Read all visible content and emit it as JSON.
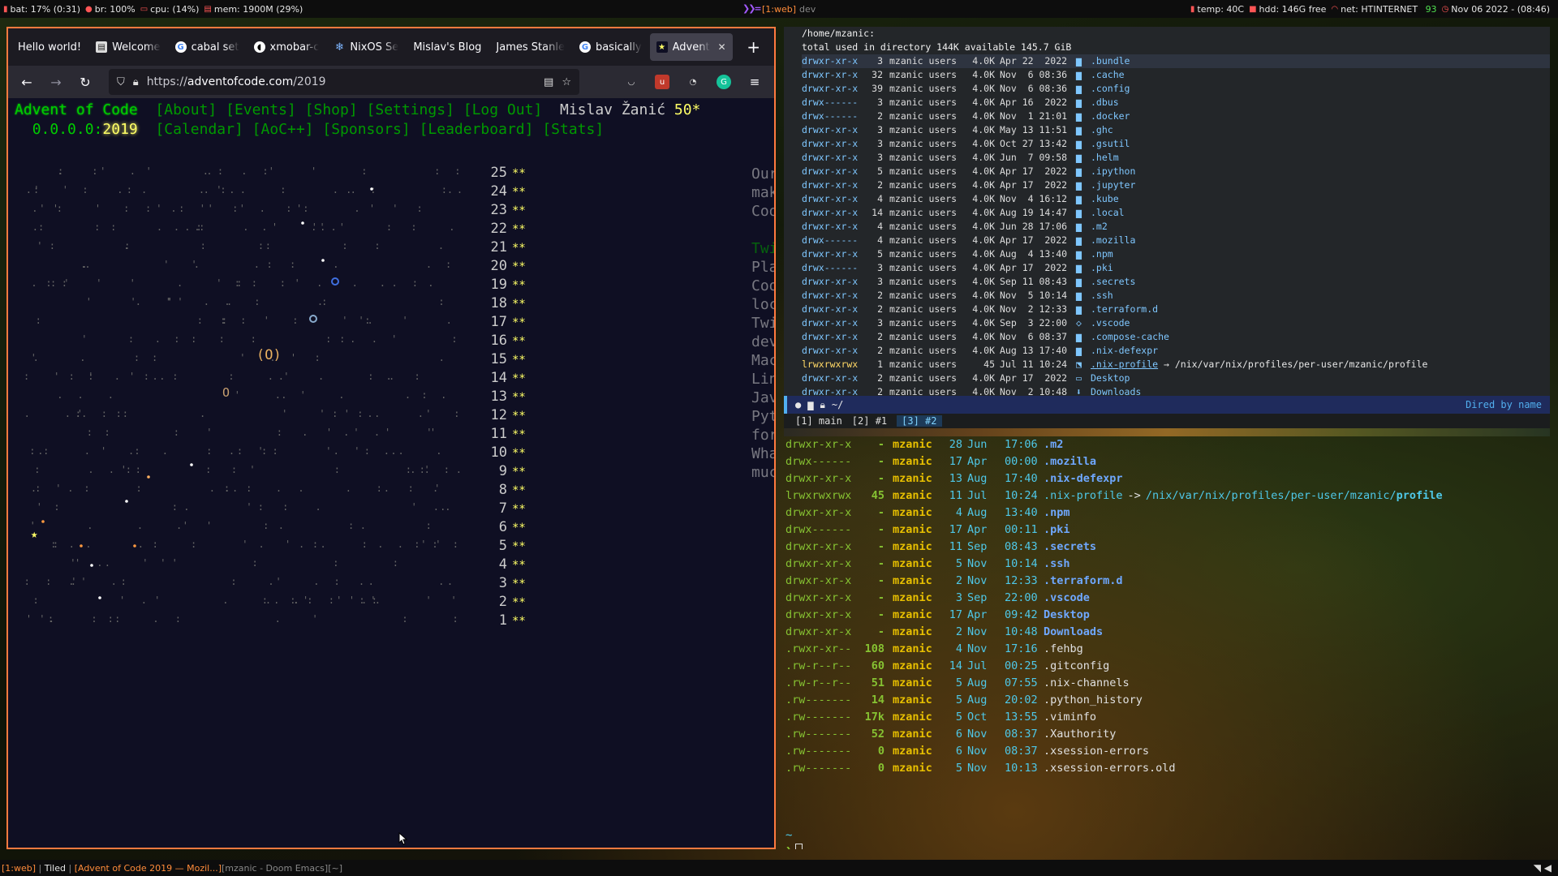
{
  "topbar": {
    "battery": "bat: 17% (0:31)",
    "brightness": "br: 100%",
    "cpu": "cpu: (14%)",
    "mem": "mem: 1900M (29%)",
    "workspace": "[1:web]",
    "workspace_name": "dev",
    "temp": "temp: 40C",
    "hdd": "hdd: 146G free",
    "net": "net: HTINTERNET",
    "net_strength": "93",
    "datetime": "Nov 06 2022 - (08:46)"
  },
  "firefox": {
    "tabs": [
      {
        "label": "Hello world!",
        "icon": "none"
      },
      {
        "label": "Welcome",
        "icon": "book-icon"
      },
      {
        "label": "cabal set",
        "icon": "google-icon"
      },
      {
        "label": "xmobar-c",
        "icon": "github-icon"
      },
      {
        "label": "NixOS Se",
        "icon": "nixos-icon"
      },
      {
        "label": "Mislav's Blog",
        "icon": "none"
      },
      {
        "label": "James Stanle",
        "icon": "none"
      },
      {
        "label": "basically",
        "icon": "google-icon"
      },
      {
        "label": "Advent",
        "icon": "star-icon"
      }
    ],
    "url_prefix": "https://",
    "url_host": "adventofcode.com",
    "url_path": "/2019"
  },
  "aoc": {
    "title": "Advent of Code",
    "nav1": [
      "[About]",
      "[Events]",
      "[Shop]",
      "[Settings]",
      "[Log Out]"
    ],
    "user": "Mislav Žanić",
    "stars": "50*",
    "year_prefix": "0.0.0.0:",
    "year": "2019",
    "nav2": [
      "[Calendar]",
      "[AoC++]",
      "[Sponsors]",
      "[Leaderboard]",
      "[Stats]"
    ],
    "days": [
      "25",
      "24",
      "23",
      "22",
      "21",
      "20",
      "19",
      "18",
      "17",
      "16",
      "15",
      "14",
      "13",
      "12",
      "11",
      "10",
      "9",
      "8",
      "7",
      "6",
      "5",
      "4",
      "3",
      "2",
      "1"
    ],
    "day_stars": "**",
    "sidebar": [
      {
        "t": "Our",
        "g": false
      },
      {
        "t": "mak",
        "g": false
      },
      {
        "t": "Coo",
        "g": false
      },
      {
        "t": "",
        "g": false
      },
      {
        "t": "Twi",
        "g": true
      },
      {
        "t": "Pla",
        "g": false
      },
      {
        "t": "Coo",
        "g": false
      },
      {
        "t": "loc",
        "g": false
      },
      {
        "t": "Twi",
        "g": false
      },
      {
        "t": "dev",
        "g": false
      },
      {
        "t": "Mac",
        "g": false
      },
      {
        "t": "Lin",
        "g": false
      },
      {
        "t": "Jav",
        "g": false
      },
      {
        "t": "Pyt",
        "g": false
      },
      {
        "t": "for",
        "g": false
      },
      {
        "t": "Wha",
        "g": false
      },
      {
        "t": "muc",
        "g": false
      }
    ],
    "planet_label": "(O)",
    "small_planet_label": "O"
  },
  "dired": {
    "header": "/home/mzanic:",
    "summary": "total used in directory 144K available 145.7 GiB",
    "rows": [
      {
        "perm": "drwxr-xr-x",
        "links": "3",
        "owner": "mzanic users",
        "size": "4.0K",
        "date": "Apr 22  2022",
        "icon": "folder",
        "name": ".bundle"
      },
      {
        "perm": "drwxr-xr-x",
        "links": "32",
        "owner": "mzanic users",
        "size": "4.0K",
        "date": "Nov  6 08:36",
        "icon": "folder",
        "name": ".cache"
      },
      {
        "perm": "drwxr-xr-x",
        "links": "39",
        "owner": "mzanic users",
        "size": "4.0K",
        "date": "Nov  6 08:36",
        "icon": "folder",
        "name": ".config"
      },
      {
        "perm": "drwx------",
        "links": "3",
        "owner": "mzanic users",
        "size": "4.0K",
        "date": "Apr 16  2022",
        "icon": "folder",
        "name": ".dbus"
      },
      {
        "perm": "drwx------",
        "links": "2",
        "owner": "mzanic users",
        "size": "4.0K",
        "date": "Nov  1 21:01",
        "icon": "folder",
        "name": ".docker"
      },
      {
        "perm": "drwxr-xr-x",
        "links": "3",
        "owner": "mzanic users",
        "size": "4.0K",
        "date": "May 13 11:51",
        "icon": "folder",
        "name": ".ghc"
      },
      {
        "perm": "drwxr-xr-x",
        "links": "3",
        "owner": "mzanic users",
        "size": "4.0K",
        "date": "Oct 27 13:42",
        "icon": "folder",
        "name": ".gsutil"
      },
      {
        "perm": "drwxr-xr-x",
        "links": "3",
        "owner": "mzanic users",
        "size": "4.0K",
        "date": "Jun  7 09:58",
        "icon": "folder",
        "name": ".helm"
      },
      {
        "perm": "drwxr-xr-x",
        "links": "5",
        "owner": "mzanic users",
        "size": "4.0K",
        "date": "Apr 17  2022",
        "icon": "folder",
        "name": ".ipython"
      },
      {
        "perm": "drwxr-xr-x",
        "links": "2",
        "owner": "mzanic users",
        "size": "4.0K",
        "date": "Apr 17  2022",
        "icon": "folder",
        "name": ".jupyter"
      },
      {
        "perm": "drwxr-xr-x",
        "links": "4",
        "owner": "mzanic users",
        "size": "4.0K",
        "date": "Nov  4 16:12",
        "icon": "folder",
        "name": ".kube"
      },
      {
        "perm": "drwxr-xr-x",
        "links": "14",
        "owner": "mzanic users",
        "size": "4.0K",
        "date": "Aug 19 14:47",
        "icon": "folder",
        "name": ".local"
      },
      {
        "perm": "drwxr-xr-x",
        "links": "4",
        "owner": "mzanic users",
        "size": "4.0K",
        "date": "Jun 28 17:06",
        "icon": "folder",
        "name": ".m2"
      },
      {
        "perm": "drwx------",
        "links": "4",
        "owner": "mzanic users",
        "size": "4.0K",
        "date": "Apr 17  2022",
        "icon": "folder",
        "name": ".mozilla"
      },
      {
        "perm": "drwxr-xr-x",
        "links": "5",
        "owner": "mzanic users",
        "size": "4.0K",
        "date": "Aug  4 13:40",
        "icon": "folder",
        "name": ".npm"
      },
      {
        "perm": "drwx------",
        "links": "3",
        "owner": "mzanic users",
        "size": "4.0K",
        "date": "Apr 17  2022",
        "icon": "folder",
        "name": ".pki"
      },
      {
        "perm": "drwxr-xr-x",
        "links": "3",
        "owner": "mzanic users",
        "size": "4.0K",
        "date": "Sep 11 08:43",
        "icon": "folder",
        "name": ".secrets"
      },
      {
        "perm": "drwxr-xr-x",
        "links": "2",
        "owner": "mzanic users",
        "size": "4.0K",
        "date": "Nov  5 10:14",
        "icon": "folder",
        "name": ".ssh"
      },
      {
        "perm": "drwxr-xr-x",
        "links": "2",
        "owner": "mzanic users",
        "size": "4.0K",
        "date": "Nov  2 12:33",
        "icon": "folder",
        "name": ".terraform.d"
      },
      {
        "perm": "drwxr-xr-x",
        "links": "3",
        "owner": "mzanic users",
        "size": "4.0K",
        "date": "Sep  3 22:00",
        "icon": "code",
        "name": ".vscode"
      },
      {
        "perm": "drwxr-xr-x",
        "links": "2",
        "owner": "mzanic users",
        "size": "4.0K",
        "date": "Nov  6 08:37",
        "icon": "folder",
        "name": ".compose-cache"
      },
      {
        "perm": "drwxr-xr-x",
        "links": "2",
        "owner": "mzanic users",
        "size": "4.0K",
        "date": "Aug 13 17:40",
        "icon": "folder",
        "name": ".nix-defexpr"
      },
      {
        "perm": "lrwxrwxrwx",
        "links": "1",
        "owner": "mzanic users",
        "size": "45",
        "date": "Jul 11 10:24",
        "icon": "link",
        "name": ".nix-profile",
        "target": "/nix/var/nix/profiles/per-user/mzanic/profile"
      },
      {
        "perm": "drwxr-xr-x",
        "links": "2",
        "owner": "mzanic users",
        "size": "4.0K",
        "date": "Apr 17  2022",
        "icon": "desktop",
        "name": "Desktop"
      },
      {
        "perm": "drwxr-xr-x",
        "links": "2",
        "owner": "mzanic users",
        "size": "4.0K",
        "date": "Nov  2 10:48",
        "icon": "download",
        "name": "Downloads"
      }
    ]
  },
  "modeline": {
    "path": "~/",
    "mode": "Dired by name"
  },
  "workspaces": [
    {
      "label": "[1] main",
      "active": false
    },
    {
      "label": "[2] #1",
      "active": false
    },
    {
      "label": "[3] #2",
      "active": true
    }
  ],
  "terminal": {
    "rows": [
      {
        "perm": "drwxr-xr-x",
        "size": "-",
        "user": "mzanic",
        "day": "28",
        "mon": "Jun",
        "time": "17:06",
        "name": ".m2",
        "kind": "dir"
      },
      {
        "perm": "drwx------",
        "size": "-",
        "user": "mzanic",
        "day": "17",
        "mon": "Apr",
        "time": "00:00",
        "name": ".mozilla",
        "kind": "dir"
      },
      {
        "perm": "drwxr-xr-x",
        "size": "-",
        "user": "mzanic",
        "day": "13",
        "mon": "Aug",
        "time": "17:40",
        "name": ".nix-defexpr",
        "kind": "dir"
      },
      {
        "perm": "lrwxrwxrwx",
        "size": "45",
        "user": "mzanic",
        "day": "11",
        "mon": "Jul",
        "time": "10:24",
        "name": ".nix-profile",
        "kind": "link",
        "target_dir": "/nix/var/nix/profiles/per-user/mzanic/",
        "target_file": "profile"
      },
      {
        "perm": "drwxr-xr-x",
        "size": "-",
        "user": "mzanic",
        "day": "4",
        "mon": "Aug",
        "time": "13:40",
        "name": ".npm",
        "kind": "dir"
      },
      {
        "perm": "drwx------",
        "size": "-",
        "user": "mzanic",
        "day": "17",
        "mon": "Apr",
        "time": "00:11",
        "name": ".pki",
        "kind": "dir"
      },
      {
        "perm": "drwxr-xr-x",
        "size": "-",
        "user": "mzanic",
        "day": "11",
        "mon": "Sep",
        "time": "08:43",
        "name": ".secrets",
        "kind": "dir"
      },
      {
        "perm": "drwxr-xr-x",
        "size": "-",
        "user": "mzanic",
        "day": "5",
        "mon": "Nov",
        "time": "10:14",
        "name": ".ssh",
        "kind": "dir"
      },
      {
        "perm": "drwxr-xr-x",
        "size": "-",
        "user": "mzanic",
        "day": "2",
        "mon": "Nov",
        "time": "12:33",
        "name": ".terraform.d",
        "kind": "dir"
      },
      {
        "perm": "drwxr-xr-x",
        "size": "-",
        "user": "mzanic",
        "day": "3",
        "mon": "Sep",
        "time": "22:00",
        "name": ".vscode",
        "kind": "dir"
      },
      {
        "perm": "drwxr-xr-x",
        "size": "-",
        "user": "mzanic",
        "day": "17",
        "mon": "Apr",
        "time": "09:42",
        "name": "Desktop",
        "kind": "dir"
      },
      {
        "perm": "drwxr-xr-x",
        "size": "-",
        "user": "mzanic",
        "day": "2",
        "mon": "Nov",
        "time": "10:48",
        "name": "Downloads",
        "kind": "dir"
      },
      {
        "perm": ".rwxr-xr--",
        "size": "108",
        "user": "mzanic",
        "day": "4",
        "mon": "Nov",
        "time": "17:16",
        "name": ".fehbg",
        "kind": "file"
      },
      {
        "perm": ".rw-r--r--",
        "size": "60",
        "user": "mzanic",
        "day": "14",
        "mon": "Jul",
        "time": "00:25",
        "name": ".gitconfig",
        "kind": "file"
      },
      {
        "perm": ".rw-r--r--",
        "size": "51",
        "user": "mzanic",
        "day": "5",
        "mon": "Aug",
        "time": "07:55",
        "name": ".nix-channels",
        "kind": "file"
      },
      {
        "perm": ".rw-------",
        "size": "14",
        "user": "mzanic",
        "day": "5",
        "mon": "Aug",
        "time": "20:02",
        "name": ".python_history",
        "kind": "file"
      },
      {
        "perm": ".rw-------",
        "size": "17k",
        "user": "mzanic",
        "day": "5",
        "mon": "Oct",
        "time": "13:55",
        "name": ".viminfo",
        "kind": "file"
      },
      {
        "perm": ".rw-------",
        "size": "52",
        "user": "mzanic",
        "day": "6",
        "mon": "Nov",
        "time": "08:37",
        "name": ".Xauthority",
        "kind": "file"
      },
      {
        "perm": ".rw-------",
        "size": "0",
        "user": "mzanic",
        "day": "6",
        "mon": "Nov",
        "time": "08:37",
        "name": ".xsession-errors",
        "kind": "file"
      },
      {
        "perm": ".rw-------",
        "size": "0",
        "user": "mzanic",
        "day": "5",
        "mon": "Nov",
        "time": "10:13",
        "name": ".xsession-errors.old",
        "kind": "file"
      }
    ],
    "prompt_dir": "~",
    "prompt_symbol": "❯"
  },
  "bottombar": {
    "workspace": "[1:web]",
    "layout": "Tiled",
    "active_window": "[Advent of Code 2019 — Mozil...]",
    "inactive_window": "[mzanic - Doom Emacs]",
    "other": "[~]"
  }
}
